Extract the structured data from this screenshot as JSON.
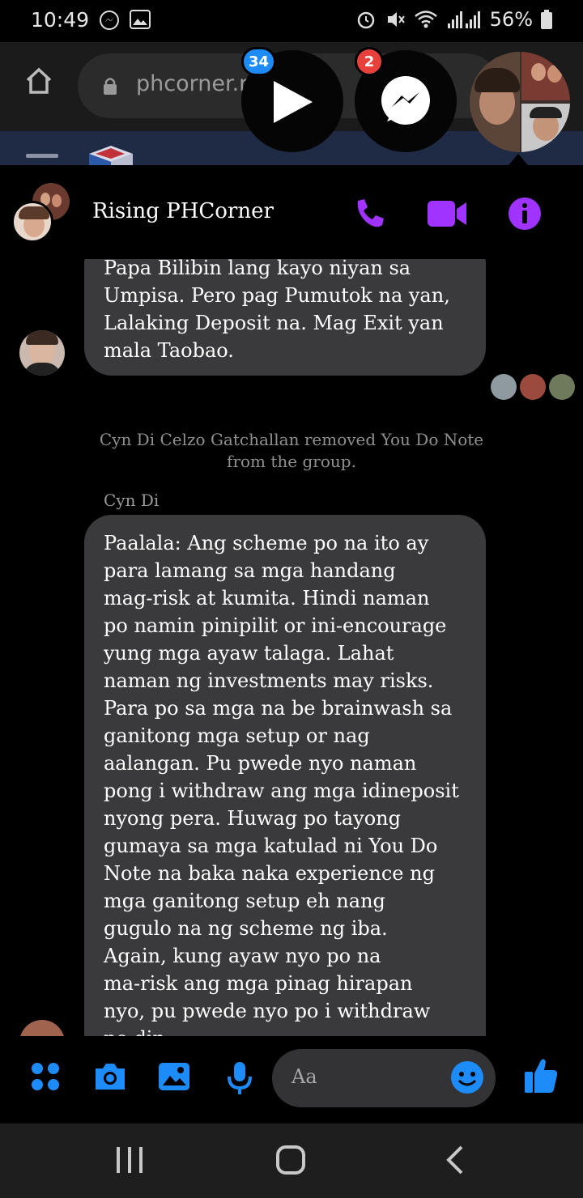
{
  "status_bar": {
    "time": "10:49",
    "battery": "56%",
    "icons": [
      "messenger-icon",
      "gallery-icon",
      "alarm-icon",
      "mute-icon",
      "wifi-icon",
      "signal-icon",
      "battery-icon"
    ]
  },
  "browser": {
    "url": "phcorner.r"
  },
  "chat_heads": {
    "video_badge": "34",
    "messenger_badge": "2"
  },
  "chat": {
    "title": "Rising PHCorner",
    "accent": "#a033ff"
  },
  "messages": {
    "first_bubble": "Papa Bilibin lang kayo niyan sa\nUmpisa. Pero pag Pumutok na yan,\nLalaking Deposit na. Mag Exit yan\nmala Taobao.",
    "system": "Cyn Di Celzo Gatchallan removed You Do Note from the group.",
    "sender": "Cyn Di",
    "second_bubble": "Paalala: Ang scheme po na ito ay\npara lamang sa mga handang\nmag-risk at kumita. Hindi naman\npo namin pinipilit  or ini-encourage\nyung mga ayaw talaga. Lahat\nnaman ng investments may risks.\nPara po sa mga na be brainwash sa\nganitong mga setup or nag\naalangan. Pu pwede nyo naman\npong i withdraw ang mga idineposit\nnyong pera. Huwag po tayong\ngumaya sa mga katulad ni You Do\nNote na baka naka experience ng\nmga ganitong setup eh nang\ngugulo na ng scheme ng iba.\nAgain, kung ayaw nyo po na\nma-risk ang mga pinag hirapan\nnyo, pu pwede nyo po i withdraw\npo din."
  },
  "composer": {
    "placeholder": "Aa",
    "accent": "#1d8cf8"
  }
}
